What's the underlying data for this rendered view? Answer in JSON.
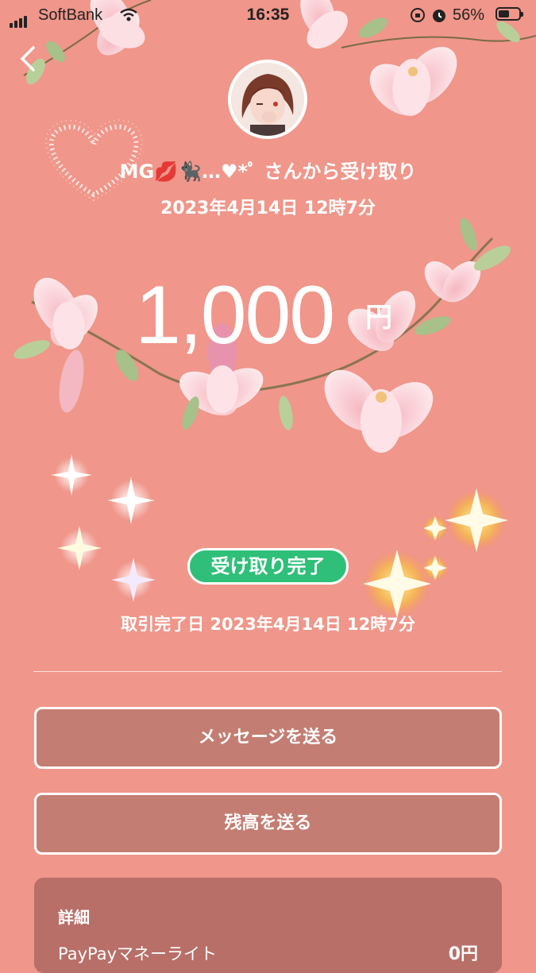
{
  "status_bar": {
    "carrier": "SoftBank",
    "time": "16:35",
    "battery_percent": "56%",
    "battery_level": 0.56
  },
  "header": {
    "back_icon": "chevron-left-icon"
  },
  "transfer": {
    "sender_line": "MG💋🐈‍⬛…♥*ﾟ さんから受け取り",
    "received_datetime": "2023年4月14日 12時7分",
    "amount": "1,000",
    "currency_unit": "円",
    "status_badge": "受け取り完了",
    "completed_label": "取引完了日 2023年4月14日 12時7分"
  },
  "actions": {
    "send_message": "メッセージを送る",
    "send_balance": "残高を送る"
  },
  "details": {
    "title": "詳細",
    "row_label": "PayPayマネーライト",
    "row_value": "0円"
  },
  "colors": {
    "background": "#f0968a",
    "button_fill": "#c47d72",
    "badge_green": "#2fbf79",
    "details_panel": "#b86f68"
  }
}
